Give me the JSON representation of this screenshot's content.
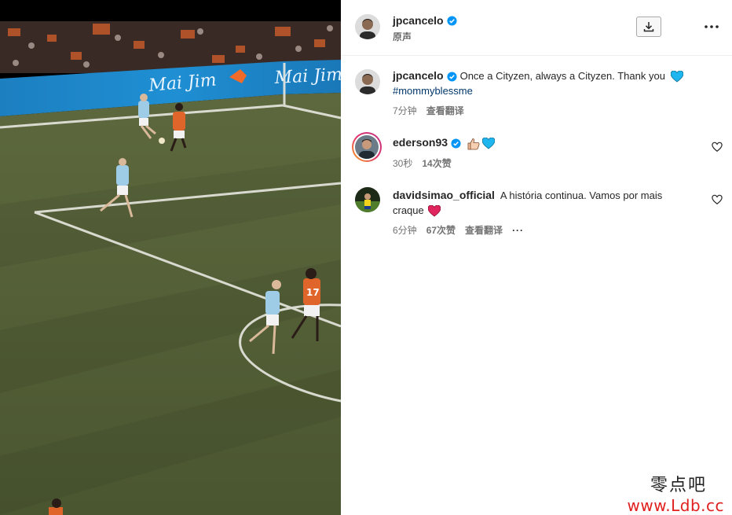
{
  "post": {
    "author": "jpcancelo",
    "audio": "原声",
    "icons": {
      "download": "download-icon",
      "more": "more-horizontal-icon",
      "verified": "verified-badge-icon"
    }
  },
  "caption": {
    "username": "jpcancelo",
    "text": "Once a Cityzen, always a Cityzen. Thank you",
    "emoji": "blue-heart",
    "hashtag": "#mommyblessme",
    "time": "7分钟",
    "translate": "查看翻译"
  },
  "comments": [
    {
      "username": "ederson93",
      "text": "",
      "emoji": [
        "thumbs-up",
        "blue-heart"
      ],
      "time": "30秒",
      "likes": "14次赞"
    },
    {
      "username": "davidsimao_official",
      "text_line1": "A história continua. Vamos por mais",
      "text_line2": "craque",
      "emoji": "red-heart",
      "time": "6分钟",
      "likes": "67次赞",
      "translate": "查看翻译",
      "more": "···"
    }
  ],
  "watermark": {
    "cn": "零点吧",
    "url": "www.Ldb.cc"
  },
  "colors": {
    "verified": "#0095f6",
    "blue_heart": "#1fb6ef",
    "red_heart": "#e0245e",
    "pitch": "#56613a"
  }
}
